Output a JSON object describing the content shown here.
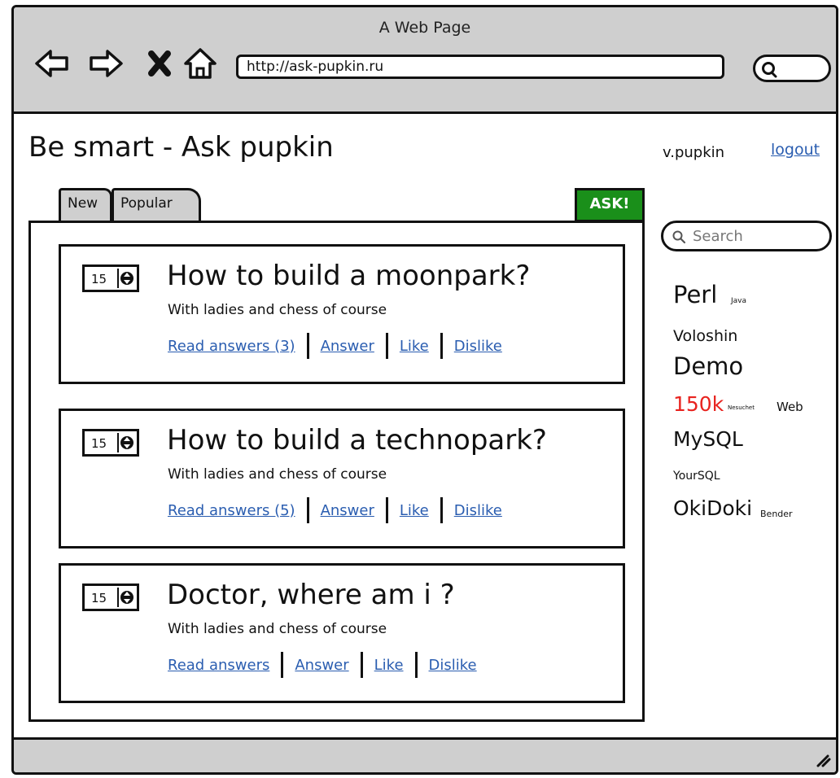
{
  "window": {
    "title": "A Web Page",
    "address": "http://ask-pupkin.ru"
  },
  "header": {
    "site_title": "Be smart - Ask pupkin",
    "username": "v.pupkin",
    "logout": "logout"
  },
  "tabs": [
    {
      "label": "New"
    },
    {
      "label": "Popular"
    }
  ],
  "ask_button": "ASK!",
  "questions": [
    {
      "rating": "15",
      "title": "How to build a moonpark?",
      "subtitle": "With ladies and chess of course",
      "links": {
        "read": "Read answers (3)",
        "answer": "Answer",
        "like": "Like",
        "dislike": "Dislike"
      }
    },
    {
      "rating": "15",
      "title": "How to build a technopark?",
      "subtitle": "With ladies and chess of course",
      "links": {
        "read": "Read answers (5)",
        "answer": "Answer",
        "like": "Like",
        "dislike": "Dislike"
      }
    },
    {
      "rating": "15",
      "title": "Doctor, where am i ?",
      "subtitle": "With ladies and chess of course",
      "links": {
        "read": "Read answers",
        "answer": "Answer",
        "like": "Like",
        "dislike": "Dislike"
      }
    }
  ],
  "sidebar": {
    "search_placeholder": "Search",
    "tags": [
      {
        "label": "Perl"
      },
      {
        "label": "Java"
      },
      {
        "label": "Voloshin"
      },
      {
        "label": "Demo"
      },
      {
        "label": "150k"
      },
      {
        "label": "Nesuchet"
      },
      {
        "label": "Web"
      },
      {
        "label": "MySQL"
      },
      {
        "label": "YourSQL"
      },
      {
        "label": "OkiDoki"
      },
      {
        "label": "Bender"
      }
    ]
  },
  "colors": {
    "chrome": "#cfcfcf",
    "link": "#2a5db0",
    "ask_button": "#1a8f1a",
    "tag_highlight": "#e8231f"
  },
  "icons": {
    "back": "back-arrow-icon",
    "forward": "forward-arrow-icon",
    "stop": "close-icon",
    "home": "home-icon",
    "search": "search-icon"
  }
}
